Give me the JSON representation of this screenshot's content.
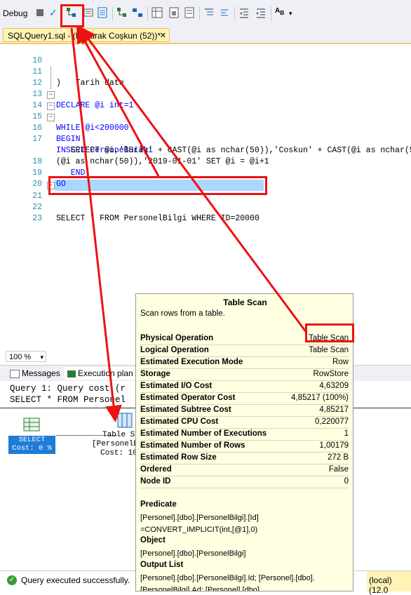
{
  "toolbar": {
    "debug_label": "Debug"
  },
  "doc_tab": {
    "title": "SQLQuery1.sql - (l...Burak Coşkun (52))*",
    "close": "✕"
  },
  "editor": {
    "lines": [
      {
        "num": "10",
        "text": "    Tarih date"
      },
      {
        "num": "11",
        "text": ")"
      },
      {
        "num": "12",
        "text": ""
      },
      {
        "num": "13",
        "text": "DECLARE @i int=1"
      },
      {
        "num": "14",
        "text": "WHILE @i<200000"
      },
      {
        "num": "15",
        "text": "BEGIN"
      },
      {
        "num": "16",
        "text": "INSERT PersonelBilgi"
      },
      {
        "num": "17",
        "text": "   SELECT @i,'Burak' + CAST(@i as nchar(50)),'Coskun' + CAST(@i as nchar(5"
      },
      {
        "num": "",
        "text": "(@i as nchar(50)),'2019-01-01' SET @i = @i+1"
      },
      {
        "num": "18",
        "text": "   END"
      },
      {
        "num": "19",
        "text": "GO"
      },
      {
        "num": "20",
        "text": ""
      },
      {
        "num": "21",
        "text": "SELECT * FROM PersonelBilgi WHERE ID=20000"
      },
      {
        "num": "22",
        "text": ""
      },
      {
        "num": "23",
        "text": ""
      }
    ]
  },
  "zoom": {
    "value": "100 %"
  },
  "result_tabs": {
    "messages": "Messages",
    "execution_plan": "Execution plan"
  },
  "results": {
    "query_header": "Query 1: Query cost (r",
    "query_text": "SELECT * FROM Personel",
    "select_node": {
      "label": "SELECT",
      "cost": "Cost: 0 %"
    },
    "scan_node": {
      "label": "Table S",
      "object": "[PersonelB",
      "cost": "Cost: 10"
    }
  },
  "tooltip": {
    "title": "Table Scan",
    "description": "Scan rows from a table.",
    "rows": [
      {
        "label": "Physical Operation",
        "value": "Table Scan"
      },
      {
        "label": "Logical Operation",
        "value": "Table Scan"
      },
      {
        "label": "Estimated Execution Mode",
        "value": "Row"
      },
      {
        "label": "Storage",
        "value": "RowStore"
      },
      {
        "label": "Estimated I/O Cost",
        "value": "4,63209"
      },
      {
        "label": "Estimated Operator Cost",
        "value": "4,85217 (100%)"
      },
      {
        "label": "Estimated Subtree Cost",
        "value": "4,85217"
      },
      {
        "label": "Estimated CPU Cost",
        "value": "0,220077"
      },
      {
        "label": "Estimated Number of Executions",
        "value": "1"
      },
      {
        "label": "Estimated Number of Rows",
        "value": "1,00179"
      },
      {
        "label": "Estimated Row Size",
        "value": "272 B"
      },
      {
        "label": "Ordered",
        "value": "False"
      },
      {
        "label": "Node ID",
        "value": "0"
      }
    ],
    "predicate_heading": "Predicate",
    "predicate_line1": "[Personel].[dbo].[PersonelBilgi].[Id]",
    "predicate_line2": "=CONVERT_IMPLICIT(int,[@1],0)",
    "object_heading": "Object",
    "object_value": "[Personel].[dbo].[PersonelBilgi]",
    "output_heading": "Output List",
    "output_line1": "[Personel].[dbo].[PersonelBilgi].Id; [Personel].[dbo].",
    "output_line2": "[PersonelBilgi].Ad; [Personel].[dbo]."
  },
  "status": {
    "message": "Query executed successfully.",
    "server": "(local) (12.0"
  },
  "colors": {
    "annotation_red": "#ee1111",
    "selection": "#add6ff",
    "tooltip_bg": "#ffffe1"
  }
}
